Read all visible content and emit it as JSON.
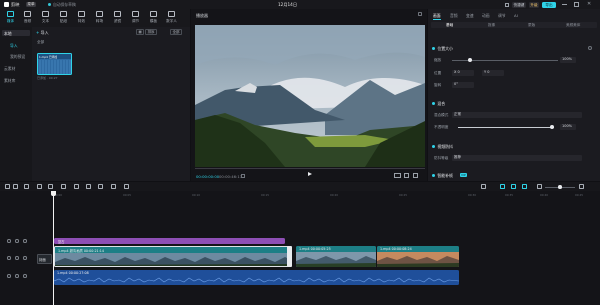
{
  "titlebar": {
    "app_name": "剪映",
    "menu_label": "菜单",
    "autosave": "自动保存草稿",
    "project_name": "12月14日",
    "shortcut_label": "快捷键",
    "upgrade_label": "升级",
    "export_label": "导出"
  },
  "tool_tabs": [
    {
      "label": "媒体",
      "icon": "media-icon",
      "active": true
    },
    {
      "label": "音频",
      "icon": "audio-icon",
      "active": false
    },
    {
      "label": "文本",
      "icon": "text-icon",
      "active": false
    },
    {
      "label": "贴纸",
      "icon": "sticker-icon",
      "active": false
    },
    {
      "label": "特效",
      "icon": "effect-icon",
      "active": false
    },
    {
      "label": "转场",
      "icon": "transition-icon",
      "active": false
    },
    {
      "label": "滤镜",
      "icon": "filter-icon",
      "active": false
    },
    {
      "label": "调节",
      "icon": "adjust-icon",
      "active": false
    },
    {
      "label": "模板",
      "icon": "template-icon",
      "active": false
    },
    {
      "label": "数字人",
      "icon": "avatar-icon",
      "active": false
    }
  ],
  "left_nav": {
    "items": [
      "本地",
      "导入",
      "我的预设",
      "云素材",
      "素材库"
    ]
  },
  "media": {
    "import_label": "导入",
    "group_label": "全部",
    "sort_label": "排序",
    "filter_label": "全部",
    "clip_filename": "1.mp4 已添加",
    "clip_meta": "已添加 · 00:27"
  },
  "player": {
    "title": "播放器",
    "current_time": "00:00:00:00",
    "total_time": "00:00:46:13"
  },
  "inspector": {
    "tabs": [
      "画面",
      "音频",
      "变速",
      "动画",
      "调节",
      "AI"
    ],
    "subtabs": [
      "基础",
      "抠像",
      "蒙版",
      "美颜美体"
    ],
    "position_section": "位置大小",
    "scale_label": "缩放",
    "scale_value": "100%",
    "position_label": "位置",
    "pos_x": "X 0",
    "pos_y": "Y 0",
    "rotate_label": "旋转",
    "rotate_value": "0°",
    "blend_section": "混合",
    "blend_mode_label": "混合模式",
    "blend_mode_value": "正常",
    "opacity_label": "不透明度",
    "opacity_value": "100%",
    "stabilize_section": "视频防抖",
    "stabilize_label": "防抖等级",
    "stabilize_value": "推荐",
    "ai_section": "智能补帧",
    "ai_badge": "VIP"
  },
  "timeline": {
    "ticks": [
      "00:00",
      "00:05",
      "00:10",
      "00:15",
      "00:20",
      "00:25",
      "00:30",
      "00:35",
      "00:40",
      "00:45"
    ],
    "main_track_label": "封面",
    "effect_clip_label": "复古",
    "clip1_label": "1.mp4  超清画质 00:00:21:14",
    "clip2_label": "1.mp4  00:00:05:25",
    "clip3_label": "1.mp4  00:00:08:24",
    "audio_clip_label": "1.mp4  00:00:27:08",
    "colors": {
      "accent": "#2fd3e8",
      "video": "#1d7f86",
      "effect": "#8e4fb5",
      "audio": "#1f4f9a"
    }
  }
}
